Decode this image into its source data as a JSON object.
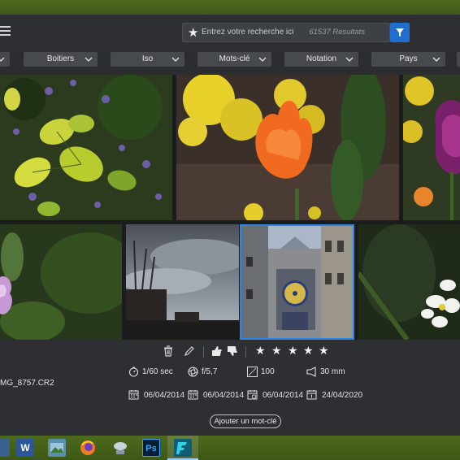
{
  "header": {
    "search_placeholder": "Entrez votre recherche ici",
    "results_count": "61537 Resultats",
    "accent": "#1e6fd0"
  },
  "filters": [
    {
      "label": ""
    },
    {
      "label": "Boitiers"
    },
    {
      "label": "Iso"
    },
    {
      "label": "Mots-clé"
    },
    {
      "label": "Notation"
    },
    {
      "label": "Pays"
    }
  ],
  "grid": {
    "photos": [
      {
        "subject": "green-yellow-foliage-photo"
      },
      {
        "subject": "orange-yellow-tulips-photo"
      },
      {
        "subject": "purple-tulip-photo"
      },
      {
        "subject": "purple-flower-photo"
      },
      {
        "subject": "cloudy-sky-trees-photo"
      },
      {
        "subject": "gros-horloge-clock-photo",
        "selected": true
      },
      {
        "subject": "white-flower-photo"
      }
    ]
  },
  "info": {
    "rating_stars": 5,
    "filename": "MG_8757.CR2",
    "shutter": "1/60 sec",
    "aperture": "f/5,7",
    "iso": "100",
    "focal": "30 mm",
    "dates": [
      "06/04/2014",
      "06/04/2014",
      "06/04/2014",
      "24/04/2020"
    ],
    "add_keyword": "Ajouter un mot-clé"
  },
  "taskbar": {
    "apps": [
      "file-explorer-icon",
      "word-icon",
      "photos-icon",
      "firefox-icon",
      "network-icon",
      "photoshop-icon",
      "app-icon"
    ]
  }
}
